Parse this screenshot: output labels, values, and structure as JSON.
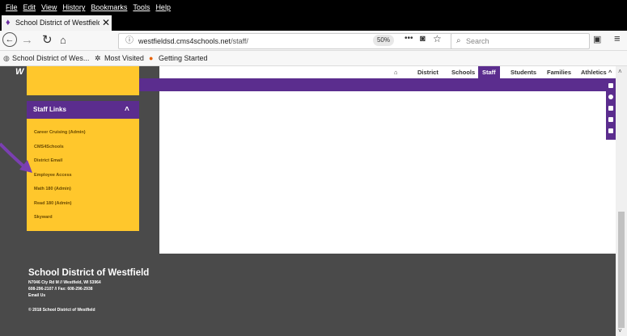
{
  "menubar": [
    "File",
    "Edit",
    "View",
    "History",
    "Bookmarks",
    "Tools",
    "Help"
  ],
  "tab": {
    "title": "School District of Westfield - N",
    "close": "✕"
  },
  "url": {
    "host": "westfieldsd.cms4schools.net",
    "path": "/staff/",
    "zoom": "50%"
  },
  "search_placeholder": "Search",
  "bookmarks": [
    "School District of Wes...",
    "Most Visited",
    "Getting Started"
  ],
  "topnav": [
    "District",
    "Schools",
    "Staff",
    "Students",
    "Families",
    "Athletics"
  ],
  "sidebar": {
    "header": "Staff Links",
    "hidden_link": "",
    "links": [
      "Career Cruising (Admin)",
      "CMS4Schools",
      "District Email",
      "Employee Access",
      "Math 180 (Admin)",
      "Read 180 (Admin)",
      "Skyward"
    ]
  },
  "footer": {
    "title": "School District of Westfield",
    "address": "N7046 Cty Rd M // Westfield, WI 53964",
    "phone": "608-296-2107 // Fax: 608-296-2938",
    "email": "Email Us",
    "copyright": "© 2018 School District of Westfield"
  },
  "colors": {
    "purple": "#5b2d8e",
    "gold": "#ffc72c",
    "footer": "#4a4a4a",
    "arrow": "#7a3fb0"
  }
}
